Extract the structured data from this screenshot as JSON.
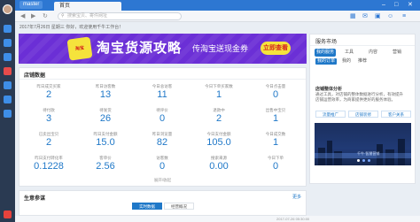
{
  "app": {
    "brand": "master",
    "tab_home": "首页",
    "address_placeholder": "搜索宝贝、寄件网址"
  },
  "greeting": "2017年7月26日 星期三 你好，欢迎使用千牛工作台！",
  "banner": {
    "badge": "淘宝",
    "title": "淘宝货源攻略",
    "subtitle": "传淘宝送现金券",
    "cta": "立即查看"
  },
  "shop_data": {
    "title": "店铺数据",
    "collapse_label": "展开/收起",
    "stats": [
      {
        "label": "昨日成交买家",
        "value": "2"
      },
      {
        "label": "昨日访客数",
        "value": "13"
      },
      {
        "label": "今日总访客",
        "value": "11"
      },
      {
        "label": "今日下单买家数",
        "value": "1"
      },
      {
        "label": "今日点击量",
        "value": "0"
      },
      {
        "label": "待付款",
        "value": "3"
      },
      {
        "label": "待发货",
        "value": "26"
      },
      {
        "label": "待评价",
        "value": "0"
      },
      {
        "label": "退款中",
        "value": "2"
      },
      {
        "label": "出售中宝贝",
        "value": "1"
      },
      {
        "label": "已卖出宝贝",
        "value": "2"
      },
      {
        "label": "昨日支付金额",
        "value": "15.0"
      },
      {
        "label": "昨日浏览量",
        "value": "82"
      },
      {
        "label": "今日支付金额",
        "value": "105.0"
      },
      {
        "label": "今日成交数",
        "value": "1"
      },
      {
        "label": "昨日支付转化率",
        "value": "0.1228"
      },
      {
        "label": "客单价",
        "value": "2.56"
      },
      {
        "label": "访客数",
        "value": "0"
      },
      {
        "label": "搜索来源",
        "value": "0.00"
      },
      {
        "label": "今日下单",
        "value": "0"
      }
    ]
  },
  "service_market": {
    "title": "服务市场",
    "tabs": [
      "我的服务",
      "工具",
      "内容",
      "营销"
    ],
    "subtabs": [
      "我的订单",
      "我的",
      "推荐"
    ],
    "section_title": "店铺整体分析",
    "section_text": "通过工具，对店铺的整体数据进行分析，有效提升店铺运营效率，为商家提供更好的服务体验。",
    "buttons": [
      "流量推广",
      "店铺装修",
      "客户关系"
    ],
    "image_caption": "千牛·智慧营销"
  },
  "bottom": {
    "title": "生意参谋",
    "more": "更多",
    "tabs": [
      "实时数据",
      "经营概况"
    ]
  },
  "statusbar": "2017-07-26 05:30:00",
  "colors": {
    "accent": "#1f78c8",
    "topbar": "#2d77d2",
    "banner": "#6b2fd6",
    "banner_yellow": "#f5e33c"
  }
}
